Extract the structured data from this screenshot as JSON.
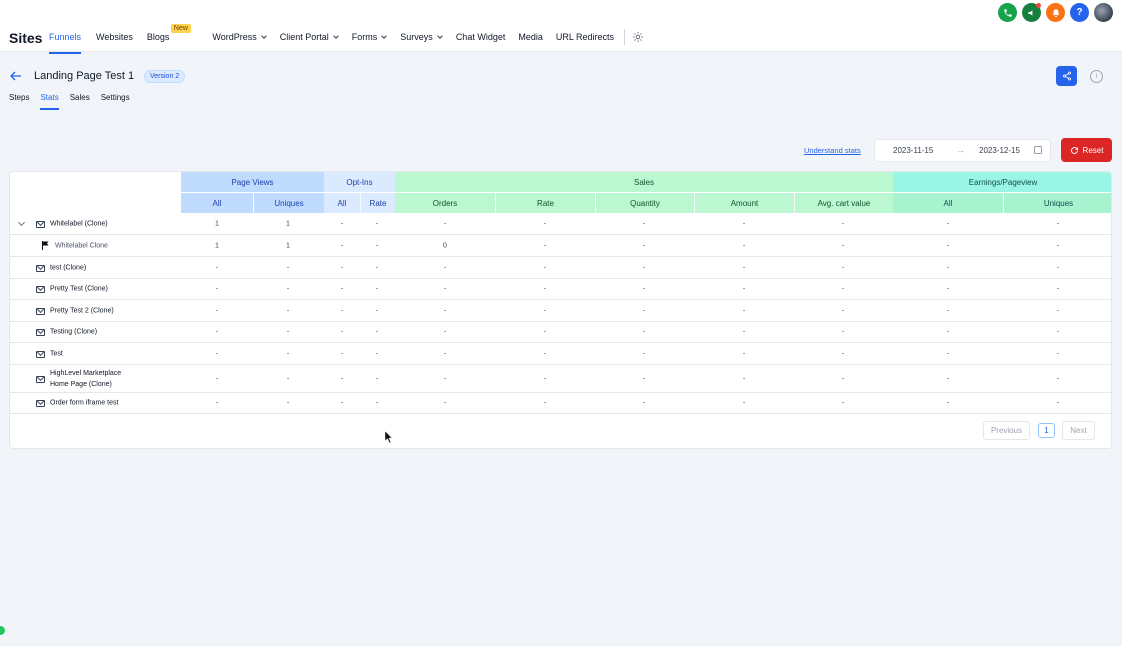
{
  "app": {
    "brand": "Sites"
  },
  "nav": {
    "items": [
      {
        "label": "Funnels",
        "active": true,
        "dropdown": false
      },
      {
        "label": "Websites",
        "active": false,
        "dropdown": false
      },
      {
        "label": "Blogs",
        "active": false,
        "dropdown": false,
        "badge": "New"
      },
      {
        "label": "WordPress",
        "active": false,
        "dropdown": true
      },
      {
        "label": "Client Portal",
        "active": false,
        "dropdown": true
      },
      {
        "label": "Forms",
        "active": false,
        "dropdown": true
      },
      {
        "label": "Surveys",
        "active": false,
        "dropdown": true
      },
      {
        "label": "Chat Widget",
        "active": false,
        "dropdown": false
      },
      {
        "label": "Media",
        "active": false,
        "dropdown": false
      },
      {
        "label": "URL Redirects",
        "active": false,
        "dropdown": false
      }
    ]
  },
  "top_icons": [
    "phone-icon",
    "megaphone-icon",
    "bell-icon",
    "help-icon",
    "user-avatar"
  ],
  "page": {
    "title": "Landing Page Test 1",
    "version": "Version 2",
    "tabs": [
      {
        "label": "Steps",
        "active": false
      },
      {
        "label": "Stats",
        "active": true
      },
      {
        "label": "Sales",
        "active": false
      },
      {
        "label": "Settings",
        "active": false
      }
    ]
  },
  "toolbar": {
    "understand_link": "Understand stats",
    "date_start": "2023-11-15",
    "date_end": "2023-12-15",
    "reset_label": "Reset"
  },
  "table": {
    "groups": {
      "page_views": "Page Views",
      "opt_ins": "Opt-Ins",
      "sales": "Sales",
      "earnings": "Earnings/Pageview"
    },
    "columns": {
      "pv_all": "All",
      "pv_uniques": "Uniques",
      "oi_all": "All",
      "oi_rate": "Rate",
      "orders": "Orders",
      "rate": "Rate",
      "quantity": "Quantity",
      "amount": "Amount",
      "avg_cart": "Avg. cart value",
      "ep_all": "All",
      "ep_uniques": "Uniques"
    },
    "rows": [
      {
        "name": "Whitelabel (Clone)",
        "values": [
          "1",
          "1",
          "-",
          "-",
          "-",
          "-",
          "-",
          "-",
          "-",
          "-",
          "-"
        ]
      },
      {
        "name": "Whitelabel Clone",
        "values": [
          "1",
          "1",
          "-",
          "-",
          "0",
          "-",
          "-",
          "-",
          "-",
          "-",
          "-"
        ]
      },
      {
        "name": "test (Clone)",
        "values": [
          "-",
          "-",
          "-",
          "-",
          "-",
          "-",
          "-",
          "-",
          "-",
          "-",
          "-"
        ]
      },
      {
        "name": "Pretty Test (Clone)",
        "values": [
          "-",
          "-",
          "-",
          "-",
          "-",
          "-",
          "-",
          "-",
          "-",
          "-",
          "-"
        ]
      },
      {
        "name": "Pretty Test 2 (Clone)",
        "values": [
          "-",
          "-",
          "-",
          "-",
          "-",
          "-",
          "-",
          "-",
          "-",
          "-",
          "-"
        ]
      },
      {
        "name": "Testing (Clone)",
        "values": [
          "-",
          "-",
          "-",
          "-",
          "-",
          "-",
          "-",
          "-",
          "-",
          "-",
          "-"
        ]
      },
      {
        "name": "Test",
        "values": [
          "-",
          "-",
          "-",
          "-",
          "-",
          "-",
          "-",
          "-",
          "-",
          "-",
          "-"
        ]
      },
      {
        "name_line1": "HighLevel Marketplace",
        "name_line2": "Home Page (Clone)",
        "values": [
          "-",
          "-",
          "-",
          "-",
          "-",
          "-",
          "-",
          "-",
          "-",
          "-",
          "-"
        ]
      },
      {
        "name": "Order form iframe test",
        "values": [
          "-",
          "-",
          "-",
          "-",
          "-",
          "-",
          "-",
          "-",
          "-",
          "-",
          "-"
        ]
      }
    ]
  },
  "pagination": {
    "previous": "Previous",
    "current": "1",
    "next": "Next"
  }
}
